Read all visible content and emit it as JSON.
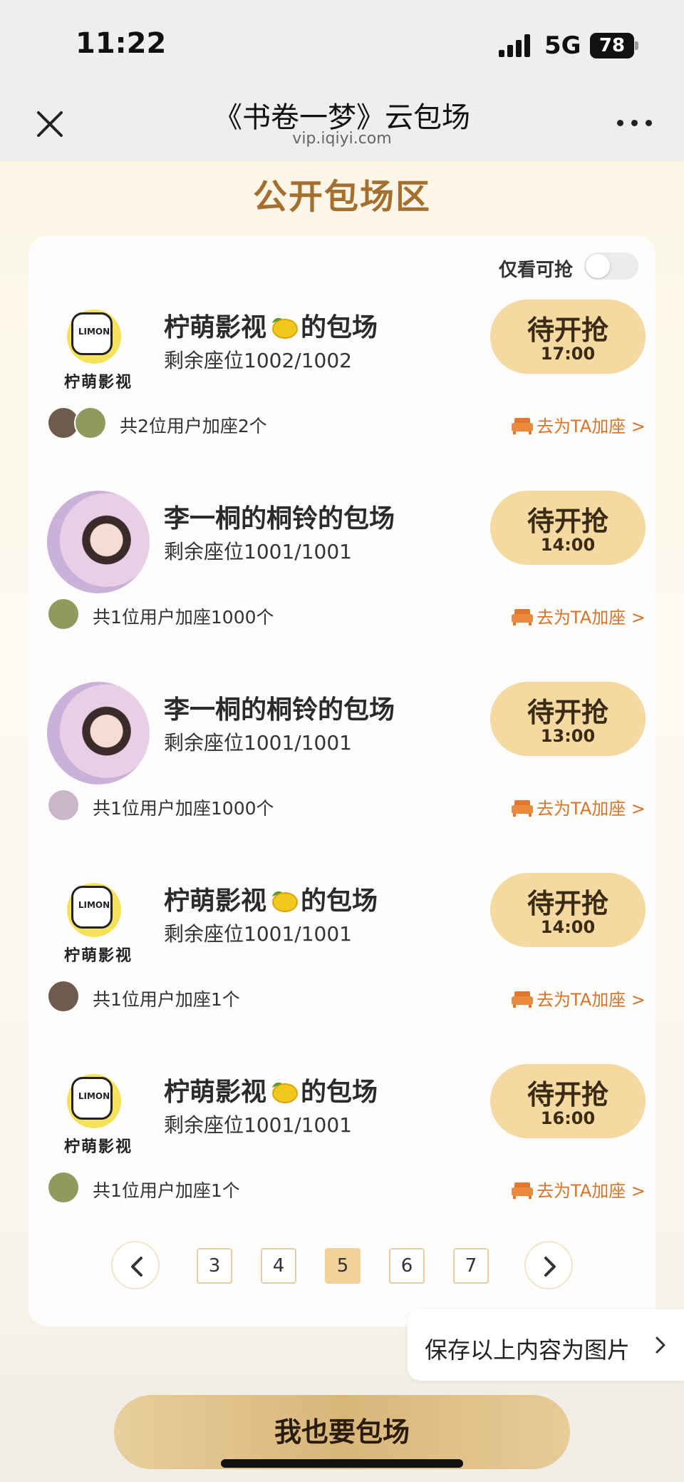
{
  "status": {
    "time": "11:22",
    "network": "5G",
    "battery": "78"
  },
  "nav": {
    "title": "《书卷一梦》云包场",
    "url": "vip.iqiyi.com"
  },
  "section_title": "公开包场区",
  "filter": {
    "label": "仅看可抢",
    "enabled": false
  },
  "logo": {
    "word": "LIMON",
    "cn": "柠萌影视"
  },
  "sessions": [
    {
      "title_prefix": "柠萌影视",
      "title_suffix": "的包场",
      "seats": "剩余座位1002/1002",
      "button": "待开抢",
      "time": "17:00",
      "users": "共2位用户加座2个",
      "link": "去为TA加座 >",
      "avatar": "logo-avatar",
      "user_avatars": 2
    },
    {
      "title_prefix": "李一桐的桐铃的包场",
      "title_suffix": "",
      "seats": "剩余座位1001/1001",
      "button": "待开抢",
      "time": "14:00",
      "users": "共1位用户加座1000个",
      "link": "去为TA加座 >",
      "avatar": "photo-avatar",
      "user_avatars": 1
    },
    {
      "title_prefix": "李一桐的桐铃的包场",
      "title_suffix": "",
      "seats": "剩余座位1001/1001",
      "button": "待开抢",
      "time": "13:00",
      "users": "共1位用户加座1000个",
      "link": "去为TA加座 >",
      "avatar": "photo-avatar",
      "user_avatars": 1
    },
    {
      "title_prefix": "柠萌影视",
      "title_suffix": "的包场",
      "seats": "剩余座位1001/1001",
      "button": "待开抢",
      "time": "14:00",
      "users": "共1位用户加座1个",
      "link": "去为TA加座 >",
      "avatar": "logo-avatar",
      "user_avatars": 1
    },
    {
      "title_prefix": "柠萌影视",
      "title_suffix": "的包场",
      "seats": "剩余座位1001/1001",
      "button": "待开抢",
      "time": "16:00",
      "users": "共1位用户加座1个",
      "link": "去为TA加座 >",
      "avatar": "logo-avatar",
      "user_avatars": 1
    }
  ],
  "pagination": {
    "pages": [
      "3",
      "4",
      "5",
      "6",
      "7"
    ],
    "current": "5"
  },
  "save_tip": "保存以上内容为图片",
  "cta": "我也要包场",
  "colors": {
    "accent": "#a5702f",
    "button_bg": "#f4d9a0",
    "link": "#d7742a",
    "cta_gold": "#d8b67a"
  },
  "icons": [
    "signal-icon",
    "battery-icon",
    "close-icon",
    "more-icon",
    "lemon-icon",
    "sofa-icon",
    "chevron-left-icon",
    "chevron-right-icon"
  ]
}
